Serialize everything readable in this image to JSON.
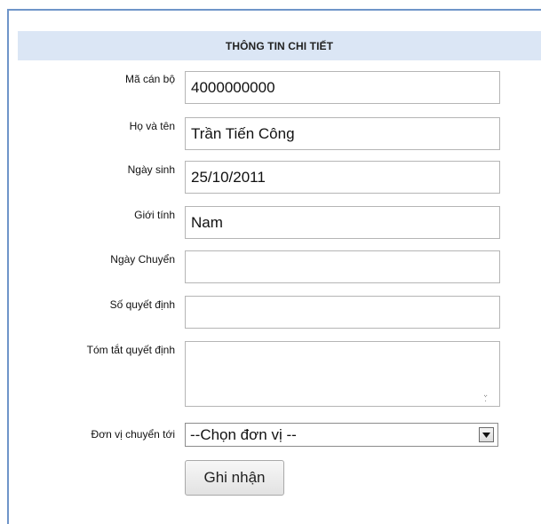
{
  "header": {
    "title": "THÔNG TIN CHI TIẾT"
  },
  "fields": [
    {
      "label": "Mã cán bộ",
      "value": "4000000000"
    },
    {
      "label": "Họ và tên",
      "value": "Trần Tiến Công"
    },
    {
      "label": "Ngày sinh",
      "value": "25/10/2011"
    },
    {
      "label": "Giới tính",
      "value": "Nam"
    },
    {
      "label": "Ngày Chuyển",
      "value": ""
    },
    {
      "label": "Số quyết định",
      "value": ""
    }
  ],
  "summary": {
    "label": "Tóm tắt quyết định",
    "value": ""
  },
  "unit": {
    "label": "Đơn vị chuyển tới",
    "selected": "--Chọn đơn vị --"
  },
  "submit": {
    "label": "Ghi nhận"
  },
  "colors": {
    "border": "#6f95c9",
    "header_bg": "#dbe6f5"
  }
}
